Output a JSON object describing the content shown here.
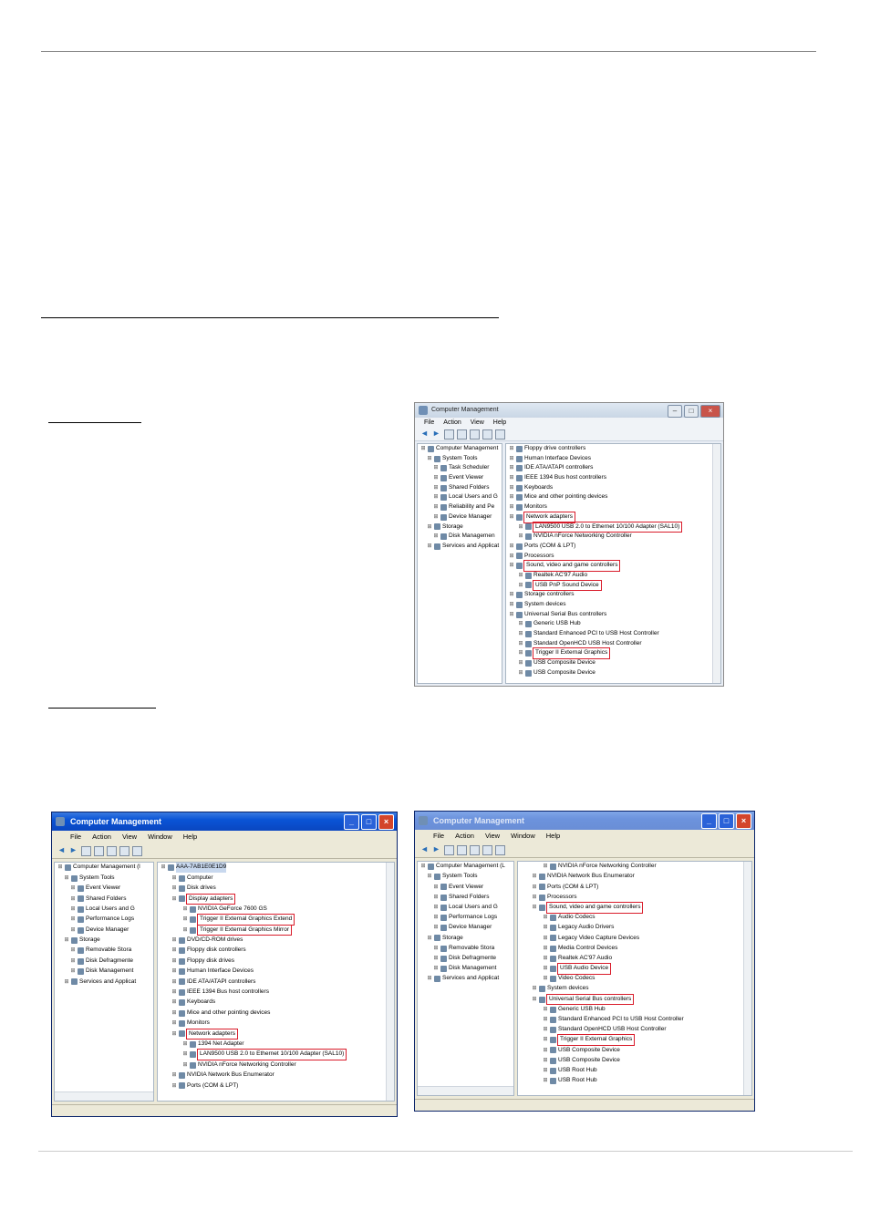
{
  "vista": {
    "title": "Computer Management",
    "menu": [
      "File",
      "Action",
      "View",
      "Help"
    ],
    "left_tree": [
      {
        "label": "Computer Management",
        "level": 0
      },
      {
        "label": "System Tools",
        "level": 1
      },
      {
        "label": "Task Scheduler",
        "level": 2
      },
      {
        "label": "Event Viewer",
        "level": 2
      },
      {
        "label": "Shared Folders",
        "level": 2
      },
      {
        "label": "Local Users and G",
        "level": 2
      },
      {
        "label": "Reliability and Pe",
        "level": 2
      },
      {
        "label": "Device Manager",
        "level": 2
      },
      {
        "label": "Storage",
        "level": 1
      },
      {
        "label": "Disk Managemen",
        "level": 2
      },
      {
        "label": "Services and Applicat",
        "level": 1
      }
    ],
    "right_tree": [
      {
        "label": "Floppy drive controllers",
        "level": 0
      },
      {
        "label": "Human Interface Devices",
        "level": 0
      },
      {
        "label": "IDE ATA/ATAPI controllers",
        "level": 0
      },
      {
        "label": "IEEE 1394 Bus host controllers",
        "level": 0
      },
      {
        "label": "Keyboards",
        "level": 0
      },
      {
        "label": "Mice and other pointing devices",
        "level": 0
      },
      {
        "label": "Monitors",
        "level": 0
      },
      {
        "label": "Network adapters",
        "level": 0,
        "hl": true
      },
      {
        "label": "LAN9500 USB 2.0 to Ethernet 10/100 Adapter (SAL10)",
        "level": 1,
        "hl": true
      },
      {
        "label": "NVIDIA nForce Networking Controller",
        "level": 1
      },
      {
        "label": "Ports (COM & LPT)",
        "level": 0
      },
      {
        "label": "Processors",
        "level": 0
      },
      {
        "label": "Sound, video and game controllers",
        "level": 0,
        "hl": true
      },
      {
        "label": "Realtek AC'97 Audio",
        "level": 1
      },
      {
        "label": "USB PnP Sound Device",
        "level": 1,
        "hl": true
      },
      {
        "label": "Storage controllers",
        "level": 0
      },
      {
        "label": "System devices",
        "level": 0
      },
      {
        "label": "Universal Serial Bus controllers",
        "level": 0
      },
      {
        "label": "Generic USB Hub",
        "level": 1
      },
      {
        "label": "Standard Enhanced PCI to USB Host Controller",
        "level": 1
      },
      {
        "label": "Standard OpenHCD USB Host Controller",
        "level": 1
      },
      {
        "label": "Trigger II External Graphics",
        "level": 1,
        "hl": true
      },
      {
        "label": "USB Composite Device",
        "level": 1
      },
      {
        "label": "USB Composite Device",
        "level": 1
      }
    ]
  },
  "xp_left": {
    "title": "Computer Management",
    "menu": [
      "File",
      "Action",
      "View",
      "Window",
      "Help"
    ],
    "left_tree": [
      {
        "label": "Computer Management (l",
        "level": 0
      },
      {
        "label": "System Tools",
        "level": 1
      },
      {
        "label": "Event Viewer",
        "level": 2
      },
      {
        "label": "Shared Folders",
        "level": 2
      },
      {
        "label": "Local Users and G",
        "level": 2
      },
      {
        "label": "Performance Logs",
        "level": 2
      },
      {
        "label": "Device Manager",
        "level": 2
      },
      {
        "label": "Storage",
        "level": 1
      },
      {
        "label": "Removable Stora",
        "level": 2
      },
      {
        "label": "Disk Defragmente",
        "level": 2
      },
      {
        "label": "Disk Management",
        "level": 2
      },
      {
        "label": "Services and Applicat",
        "level": 1
      }
    ],
    "right_tree": [
      {
        "label": "AAA-7AB1E0E1D9",
        "level": 0,
        "sel": true
      },
      {
        "label": "Computer",
        "level": 1
      },
      {
        "label": "Disk drives",
        "level": 1
      },
      {
        "label": "Display adapters",
        "level": 1,
        "hl": true
      },
      {
        "label": "NVIDIA GeForce 7600 GS",
        "level": 2
      },
      {
        "label": "Trigger II External Graphics Extend",
        "level": 2,
        "hl": true
      },
      {
        "label": "Trigger II External Graphics Mirror",
        "level": 2,
        "hl": true
      },
      {
        "label": "DVD/CD-ROM drives",
        "level": 1
      },
      {
        "label": "Floppy disk controllers",
        "level": 1
      },
      {
        "label": "Floppy disk drives",
        "level": 1
      },
      {
        "label": "Human Interface Devices",
        "level": 1
      },
      {
        "label": "IDE ATA/ATAPI controllers",
        "level": 1
      },
      {
        "label": "IEEE 1394 Bus host controllers",
        "level": 1
      },
      {
        "label": "Keyboards",
        "level": 1
      },
      {
        "label": "Mice and other pointing devices",
        "level": 1
      },
      {
        "label": "Monitors",
        "level": 1
      },
      {
        "label": "Network adapters",
        "level": 1,
        "hl": true
      },
      {
        "label": "1394 Net Adapter",
        "level": 2
      },
      {
        "label": "LAN9500 USB 2.0 to Ethernet 10/100 Adapter (SAL10)",
        "level": 2,
        "hl": true
      },
      {
        "label": "NVIDIA nForce Networking Controller",
        "level": 2
      },
      {
        "label": "NVIDIA Network Bus Enumerator",
        "level": 1
      },
      {
        "label": "Ports (COM & LPT)",
        "level": 1
      }
    ]
  },
  "xp_right": {
    "title": "Computer Management",
    "menu": [
      "File",
      "Action",
      "View",
      "Window",
      "Help"
    ],
    "left_tree": [
      {
        "label": "Computer Management (L",
        "level": 0
      },
      {
        "label": "System Tools",
        "level": 1
      },
      {
        "label": "Event Viewer",
        "level": 2
      },
      {
        "label": "Shared Folders",
        "level": 2
      },
      {
        "label": "Local Users and G",
        "level": 2
      },
      {
        "label": "Performance Logs",
        "level": 2
      },
      {
        "label": "Device Manager",
        "level": 2
      },
      {
        "label": "Storage",
        "level": 1
      },
      {
        "label": "Removable Stora",
        "level": 2
      },
      {
        "label": "Disk Defragmente",
        "level": 2
      },
      {
        "label": "Disk Management",
        "level": 2
      },
      {
        "label": "Services and Applicat",
        "level": 1
      }
    ],
    "right_tree": [
      {
        "label": "NVIDIA nForce Networking Controller",
        "level": 2
      },
      {
        "label": "NVIDIA Network Bus Enumerator",
        "level": 1
      },
      {
        "label": "Ports (COM & LPT)",
        "level": 1
      },
      {
        "label": "Processors",
        "level": 1
      },
      {
        "label": "Sound, video and game controllers",
        "level": 1,
        "hl": true
      },
      {
        "label": "Audio Codecs",
        "level": 2
      },
      {
        "label": "Legacy Audio Drivers",
        "level": 2
      },
      {
        "label": "Legacy Video Capture Devices",
        "level": 2
      },
      {
        "label": "Media Control Devices",
        "level": 2
      },
      {
        "label": "Realtek AC'97 Audio",
        "level": 2
      },
      {
        "label": "USB Audio Device",
        "level": 2,
        "hl": true
      },
      {
        "label": "Video Codecs",
        "level": 2
      },
      {
        "label": "System devices",
        "level": 1
      },
      {
        "label": "Universal Serial Bus controllers",
        "level": 1,
        "hl": true
      },
      {
        "label": "Generic USB Hub",
        "level": 2
      },
      {
        "label": "Standard Enhanced PCI to USB Host Controller",
        "level": 2
      },
      {
        "label": "Standard OpenHCD USB Host Controller",
        "level": 2
      },
      {
        "label": "Trigger II External Graphics",
        "level": 2,
        "hl": true
      },
      {
        "label": "USB Composite Device",
        "level": 2
      },
      {
        "label": "USB Composite Device",
        "level": 2
      },
      {
        "label": "USB Root Hub",
        "level": 2
      },
      {
        "label": "USB Root Hub",
        "level": 2
      }
    ]
  }
}
